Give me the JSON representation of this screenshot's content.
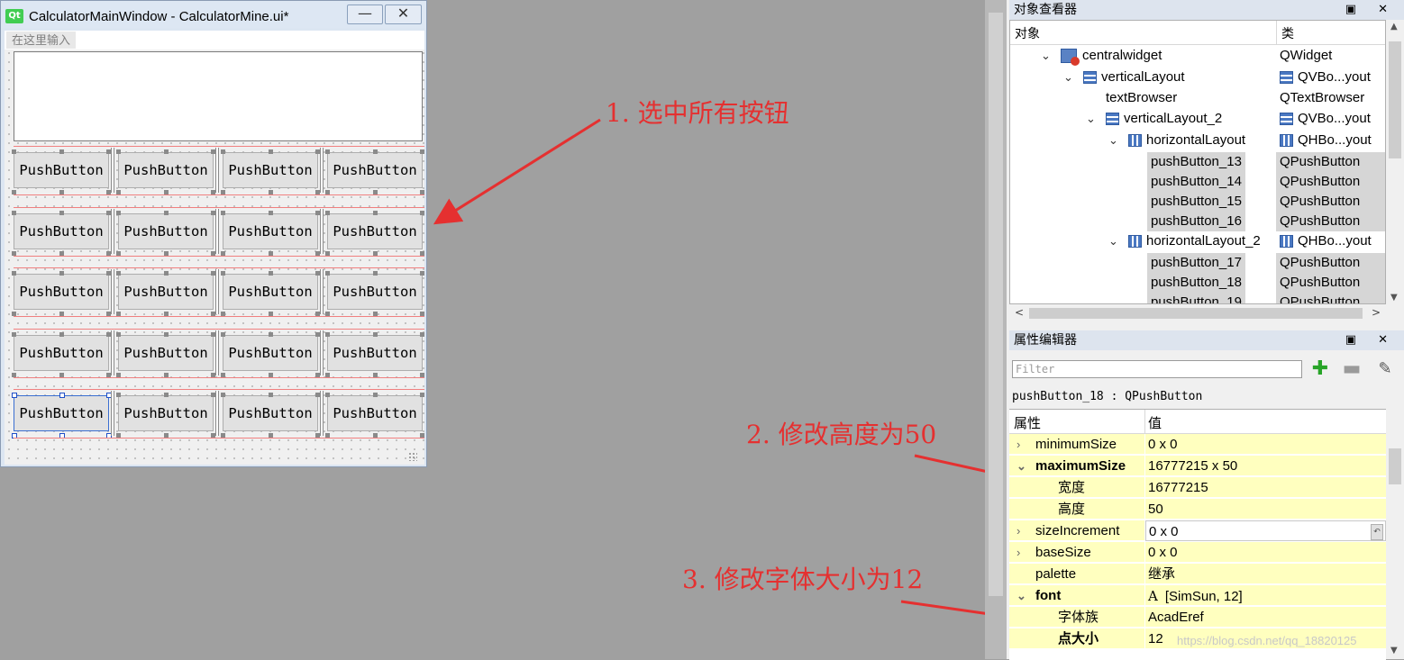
{
  "form_window": {
    "title": "CalculatorMainWindow - CalculatorMine.ui*",
    "logo": "Qt",
    "menu_placeholder": "在这里输入",
    "minimize_glyph": "—",
    "close_glyph": "✕",
    "button_label": "PushButton",
    "rows": 5,
    "columns": 4
  },
  "annotations": {
    "step1": "1. 选中所有按钮",
    "step2": "2. 修改高度为50",
    "step3": "3. 修改字体大小为12",
    "color": "#e53030"
  },
  "object_inspector": {
    "title": "对象查看器",
    "title_icons": "▣ ✕",
    "col_object": "对象",
    "col_class": "类",
    "rows": [
      {
        "name": "centralwidget",
        "cls": "QWidget",
        "icon": "widget-icon",
        "expanded": true,
        "selected": false
      },
      {
        "name": "verticalLayout",
        "cls": "QVBo...yout",
        "icon": "vbox-layout-icon",
        "expanded": true,
        "selected": false
      },
      {
        "name": "textBrowser",
        "cls": "QTextBrowser",
        "icon": "",
        "expanded": null,
        "selected": false
      },
      {
        "name": "verticalLayout_2",
        "cls": "QVBo...yout",
        "icon": "vbox-layout-icon",
        "expanded": true,
        "selected": false
      },
      {
        "name": "horizontalLayout",
        "cls": "QHBo...yout",
        "icon": "hbox-layout-icon",
        "expanded": true,
        "selected": false
      },
      {
        "name": "pushButton_13",
        "cls": "QPushButton",
        "icon": "",
        "expanded": null,
        "selected": true
      },
      {
        "name": "pushButton_14",
        "cls": "QPushButton",
        "icon": "",
        "expanded": null,
        "selected": true
      },
      {
        "name": "pushButton_15",
        "cls": "QPushButton",
        "icon": "",
        "expanded": null,
        "selected": true
      },
      {
        "name": "pushButton_16",
        "cls": "QPushButton",
        "icon": "",
        "expanded": null,
        "selected": true
      },
      {
        "name": "horizontalLayout_2",
        "cls": "QHBo...yout",
        "icon": "hbox-layout-icon",
        "expanded": true,
        "selected": false
      },
      {
        "name": "pushButton_17",
        "cls": "QPushButton",
        "icon": "",
        "expanded": null,
        "selected": true
      },
      {
        "name": "pushButton_18",
        "cls": "QPushButton",
        "icon": "",
        "expanded": null,
        "selected": true
      },
      {
        "name": "pushButton_19",
        "cls": "QPushButton",
        "icon": "",
        "expanded": null,
        "selected": true
      }
    ]
  },
  "property_editor": {
    "title": "属性编辑器",
    "title_icons": "▣ ✕",
    "filter_placeholder": "Filter",
    "add_glyph": "✚",
    "remove_glyph": "▬",
    "config_glyph": "✎",
    "object_label": "pushButton_18 : QPushButton",
    "col_property": "属性",
    "col_value": "值",
    "font_glyph": "A",
    "rows": [
      {
        "name": "minimumSize",
        "value": "0 x 0",
        "expander": "›",
        "sub": false,
        "bold": false
      },
      {
        "name": "maximumSize",
        "value": "16777215 x 50",
        "expander": "⌄",
        "sub": false,
        "bold": true
      },
      {
        "name": "宽度",
        "value": "16777215",
        "expander": "",
        "sub": true,
        "bold": false
      },
      {
        "name": "高度",
        "value": "50",
        "expander": "",
        "sub": true,
        "bold": false
      },
      {
        "name": "sizeIncrement",
        "value": "0 x 0",
        "expander": "›",
        "sub": false,
        "bold": false,
        "editing": true
      },
      {
        "name": "baseSize",
        "value": "0 x 0",
        "expander": "›",
        "sub": false,
        "bold": false
      },
      {
        "name": "palette",
        "value": "继承",
        "expander": "",
        "sub": false,
        "bold": false
      },
      {
        "name": "font",
        "value": "[SimSun, 12]",
        "expander": "⌄",
        "sub": false,
        "bold": true,
        "font_icon": true
      },
      {
        "name": "字体族",
        "value": "AcadEref",
        "expander": "",
        "sub": true,
        "bold": false
      },
      {
        "name": "点大小",
        "value": "12",
        "expander": "",
        "sub": true,
        "bold": true
      }
    ]
  },
  "watermark": "https://blog.csdn.net/qq_18820125"
}
